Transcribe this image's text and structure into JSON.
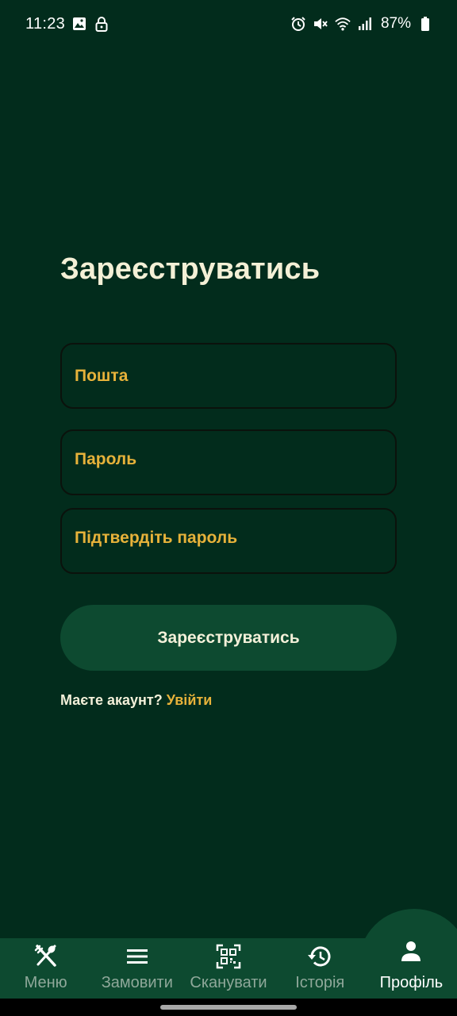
{
  "status_bar": {
    "time": "11:23",
    "battery": "87%",
    "icons": [
      "image-icon",
      "lock-icon",
      "alarm-icon",
      "mute-icon",
      "wifi-icon",
      "signal-icon",
      "battery-icon"
    ]
  },
  "form": {
    "title": "Зареєструватись",
    "email_placeholder": "Пошта",
    "password_placeholder": "Пароль",
    "confirm_placeholder": "Підтвердіть пароль",
    "submit_label": "Зареєструватись",
    "login_prompt": "Маєте акаунт?",
    "login_link": "Увійти"
  },
  "bottom_nav": {
    "items": [
      {
        "label": "Меню",
        "icon": "fork-knife-icon",
        "active": false
      },
      {
        "label": "Замовити",
        "icon": "hamburger-menu-icon",
        "active": false
      },
      {
        "label": "Сканувати",
        "icon": "qr-code-icon",
        "active": false
      },
      {
        "label": "Історія",
        "icon": "history-icon",
        "active": false
      },
      {
        "label": "Профіль",
        "icon": "person-icon",
        "active": true
      }
    ]
  },
  "colors": {
    "background": "#022c1c",
    "accent": "#e7b23a",
    "button": "#0d4a30",
    "text": "#f3f0d9"
  }
}
